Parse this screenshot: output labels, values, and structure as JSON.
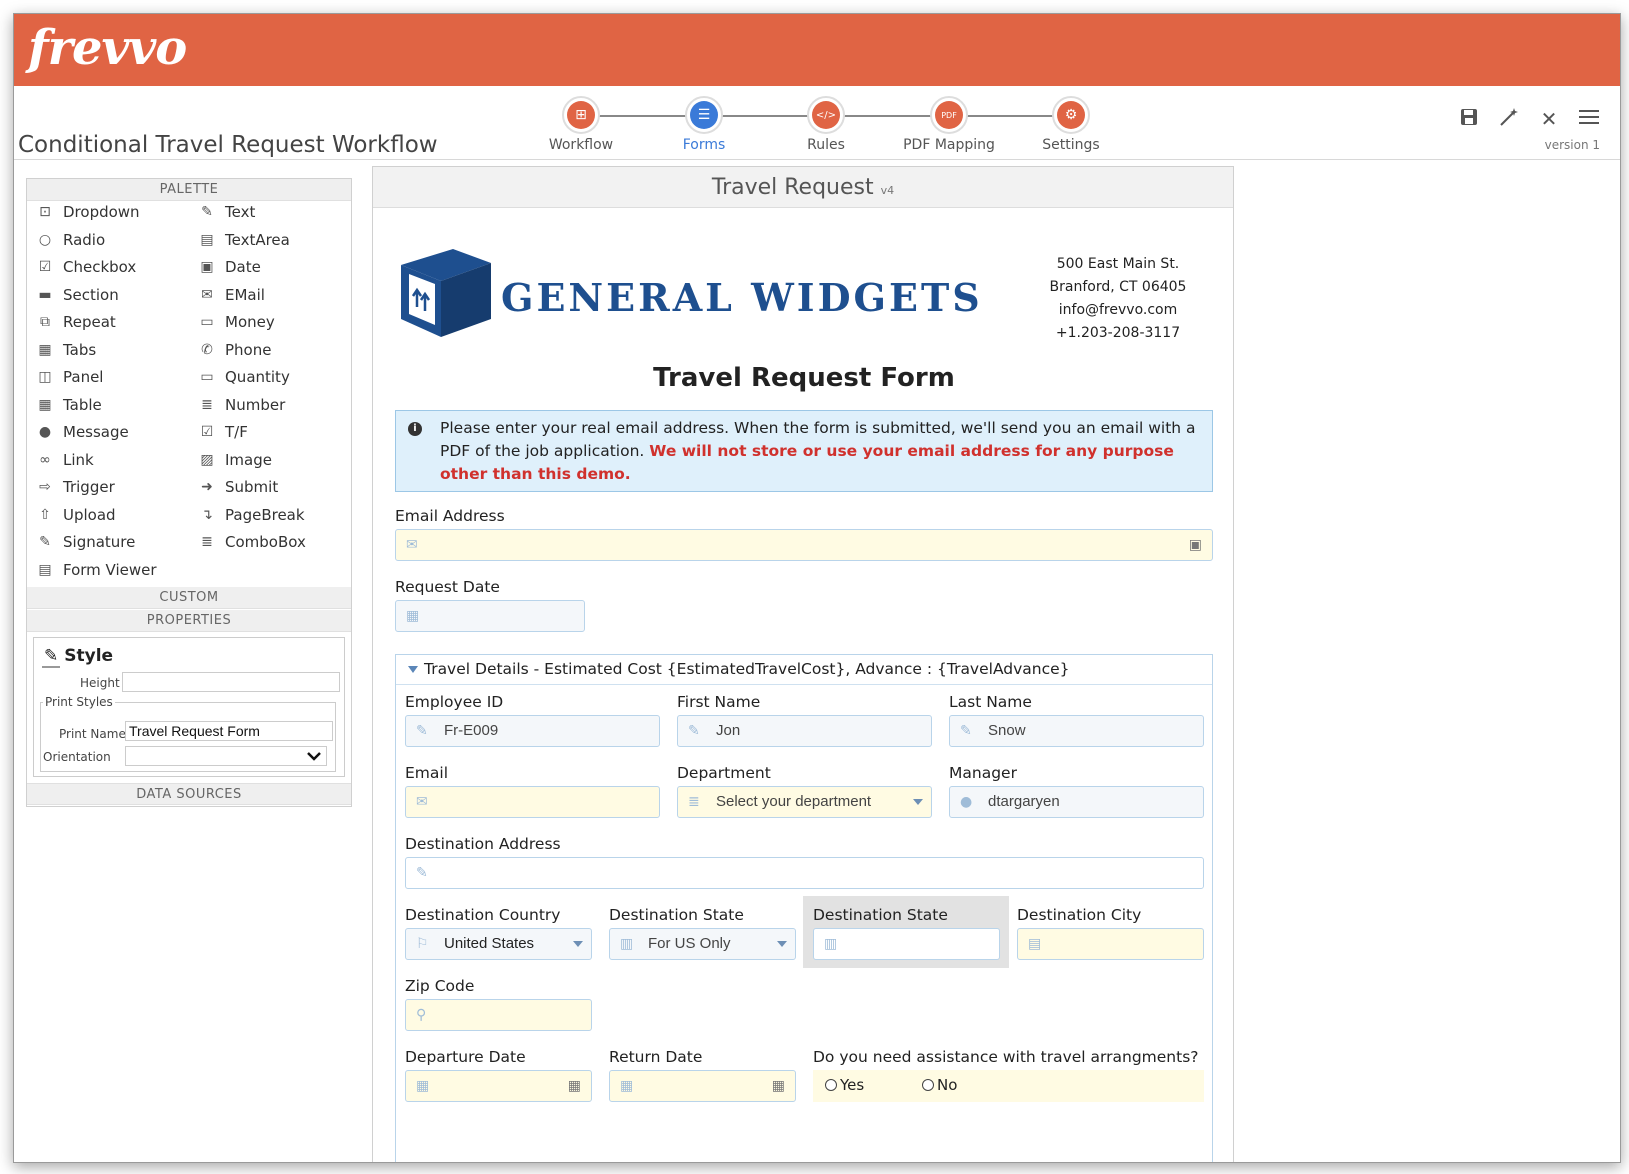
{
  "app": {
    "logo": "frevvo",
    "title": "Conditional Travel Request Workflow",
    "version": "version 1"
  },
  "steps": [
    {
      "label": "Workflow",
      "icon": "workflow-icon",
      "glyph": "⊞"
    },
    {
      "label": "Forms",
      "icon": "forms-icon",
      "glyph": "☰"
    },
    {
      "label": "Rules",
      "icon": "rules-icon",
      "glyph": "</>"
    },
    {
      "label": "PDF Mapping",
      "icon": "pdf-icon",
      "glyph": "PDF"
    },
    {
      "label": "Settings",
      "icon": "gear-icon",
      "glyph": "⚙"
    }
  ],
  "palette": {
    "header": "PALETTE",
    "left": [
      {
        "label": "Dropdown",
        "glyph": "⊡"
      },
      {
        "label": "Radio",
        "glyph": "○"
      },
      {
        "label": "Checkbox",
        "glyph": "☑"
      },
      {
        "label": "Section",
        "glyph": "▬"
      },
      {
        "label": "Repeat",
        "glyph": "⧉"
      },
      {
        "label": "Tabs",
        "glyph": "▦"
      },
      {
        "label": "Panel",
        "glyph": "◫"
      },
      {
        "label": "Table",
        "glyph": "▦"
      },
      {
        "label": "Message",
        "glyph": "●"
      },
      {
        "label": "Link",
        "glyph": "∞"
      },
      {
        "label": "Trigger",
        "glyph": "⇨"
      },
      {
        "label": "Upload",
        "glyph": "⇧"
      },
      {
        "label": "Signature",
        "glyph": "✎"
      },
      {
        "label": "Form Viewer",
        "glyph": "▤"
      }
    ],
    "right": [
      {
        "label": "Text",
        "glyph": "✎"
      },
      {
        "label": "TextArea",
        "glyph": "▤"
      },
      {
        "label": "Date",
        "glyph": "▣"
      },
      {
        "label": "EMail",
        "glyph": "✉"
      },
      {
        "label": "Money",
        "glyph": "▭"
      },
      {
        "label": "Phone",
        "glyph": "✆"
      },
      {
        "label": "Quantity",
        "glyph": "▭"
      },
      {
        "label": "Number",
        "glyph": "≣"
      },
      {
        "label": "T/F",
        "glyph": "☑"
      },
      {
        "label": "Image",
        "glyph": "▨"
      },
      {
        "label": "Submit",
        "glyph": "➜"
      },
      {
        "label": "PageBreak",
        "glyph": "↴"
      },
      {
        "label": "ComboBox",
        "glyph": "≣"
      }
    ],
    "custom": "CUSTOM",
    "properties": "PROPERTIES",
    "data_sources": "DATA SOURCES"
  },
  "style": {
    "title": "Style",
    "height_label": "Height",
    "height_value": "",
    "print_styles": "Print Styles",
    "print_name_label": "Print Name",
    "print_name_value": "Travel Request Form",
    "orientation_label": "Orientation",
    "orientation_value": ""
  },
  "form": {
    "header": "Travel Request",
    "header_version": "v4",
    "brand": "GENERAL WIDGETS",
    "address": [
      "500 East Main St.",
      "Branford, CT 06405",
      "info@frevvo.com",
      "+1.203-208-3117"
    ],
    "title": "Travel Request Form",
    "note_text": "Please enter your real email address. When the form is submitted, we'll send you an email with a PDF of the job application.",
    "note_warning": "We will not store or use your email address for any purpose other than this demo.",
    "email_label": "Email Address",
    "request_date_label": "Request Date",
    "travel_section": "Travel Details - Estimated Cost {EstimatedTravelCost}, Advance : {TravelAdvance}",
    "employee_id_label": "Employee ID",
    "employee_id": "Fr-E009",
    "first_name_label": "First Name",
    "first_name": "Jon",
    "last_name_label": "Last Name",
    "last_name": "Snow",
    "email2_label": "Email",
    "department_label": "Department",
    "department_placeholder": "Select your department",
    "manager_label": "Manager",
    "manager": "dtargaryen",
    "dest_address_label": "Destination Address",
    "dest_country_label": "Destination Country",
    "dest_country": "United States",
    "dest_state_label": "Destination State",
    "dest_state": "For US Only",
    "dest_state2_label": "Destination State",
    "dest_city_label": "Destination City",
    "zip_label": "Zip Code",
    "departure_label": "Departure Date",
    "return_label": "Return Date",
    "assist_label": "Do you need assistance with travel arrangments?",
    "yes": "Yes",
    "no": "No"
  }
}
